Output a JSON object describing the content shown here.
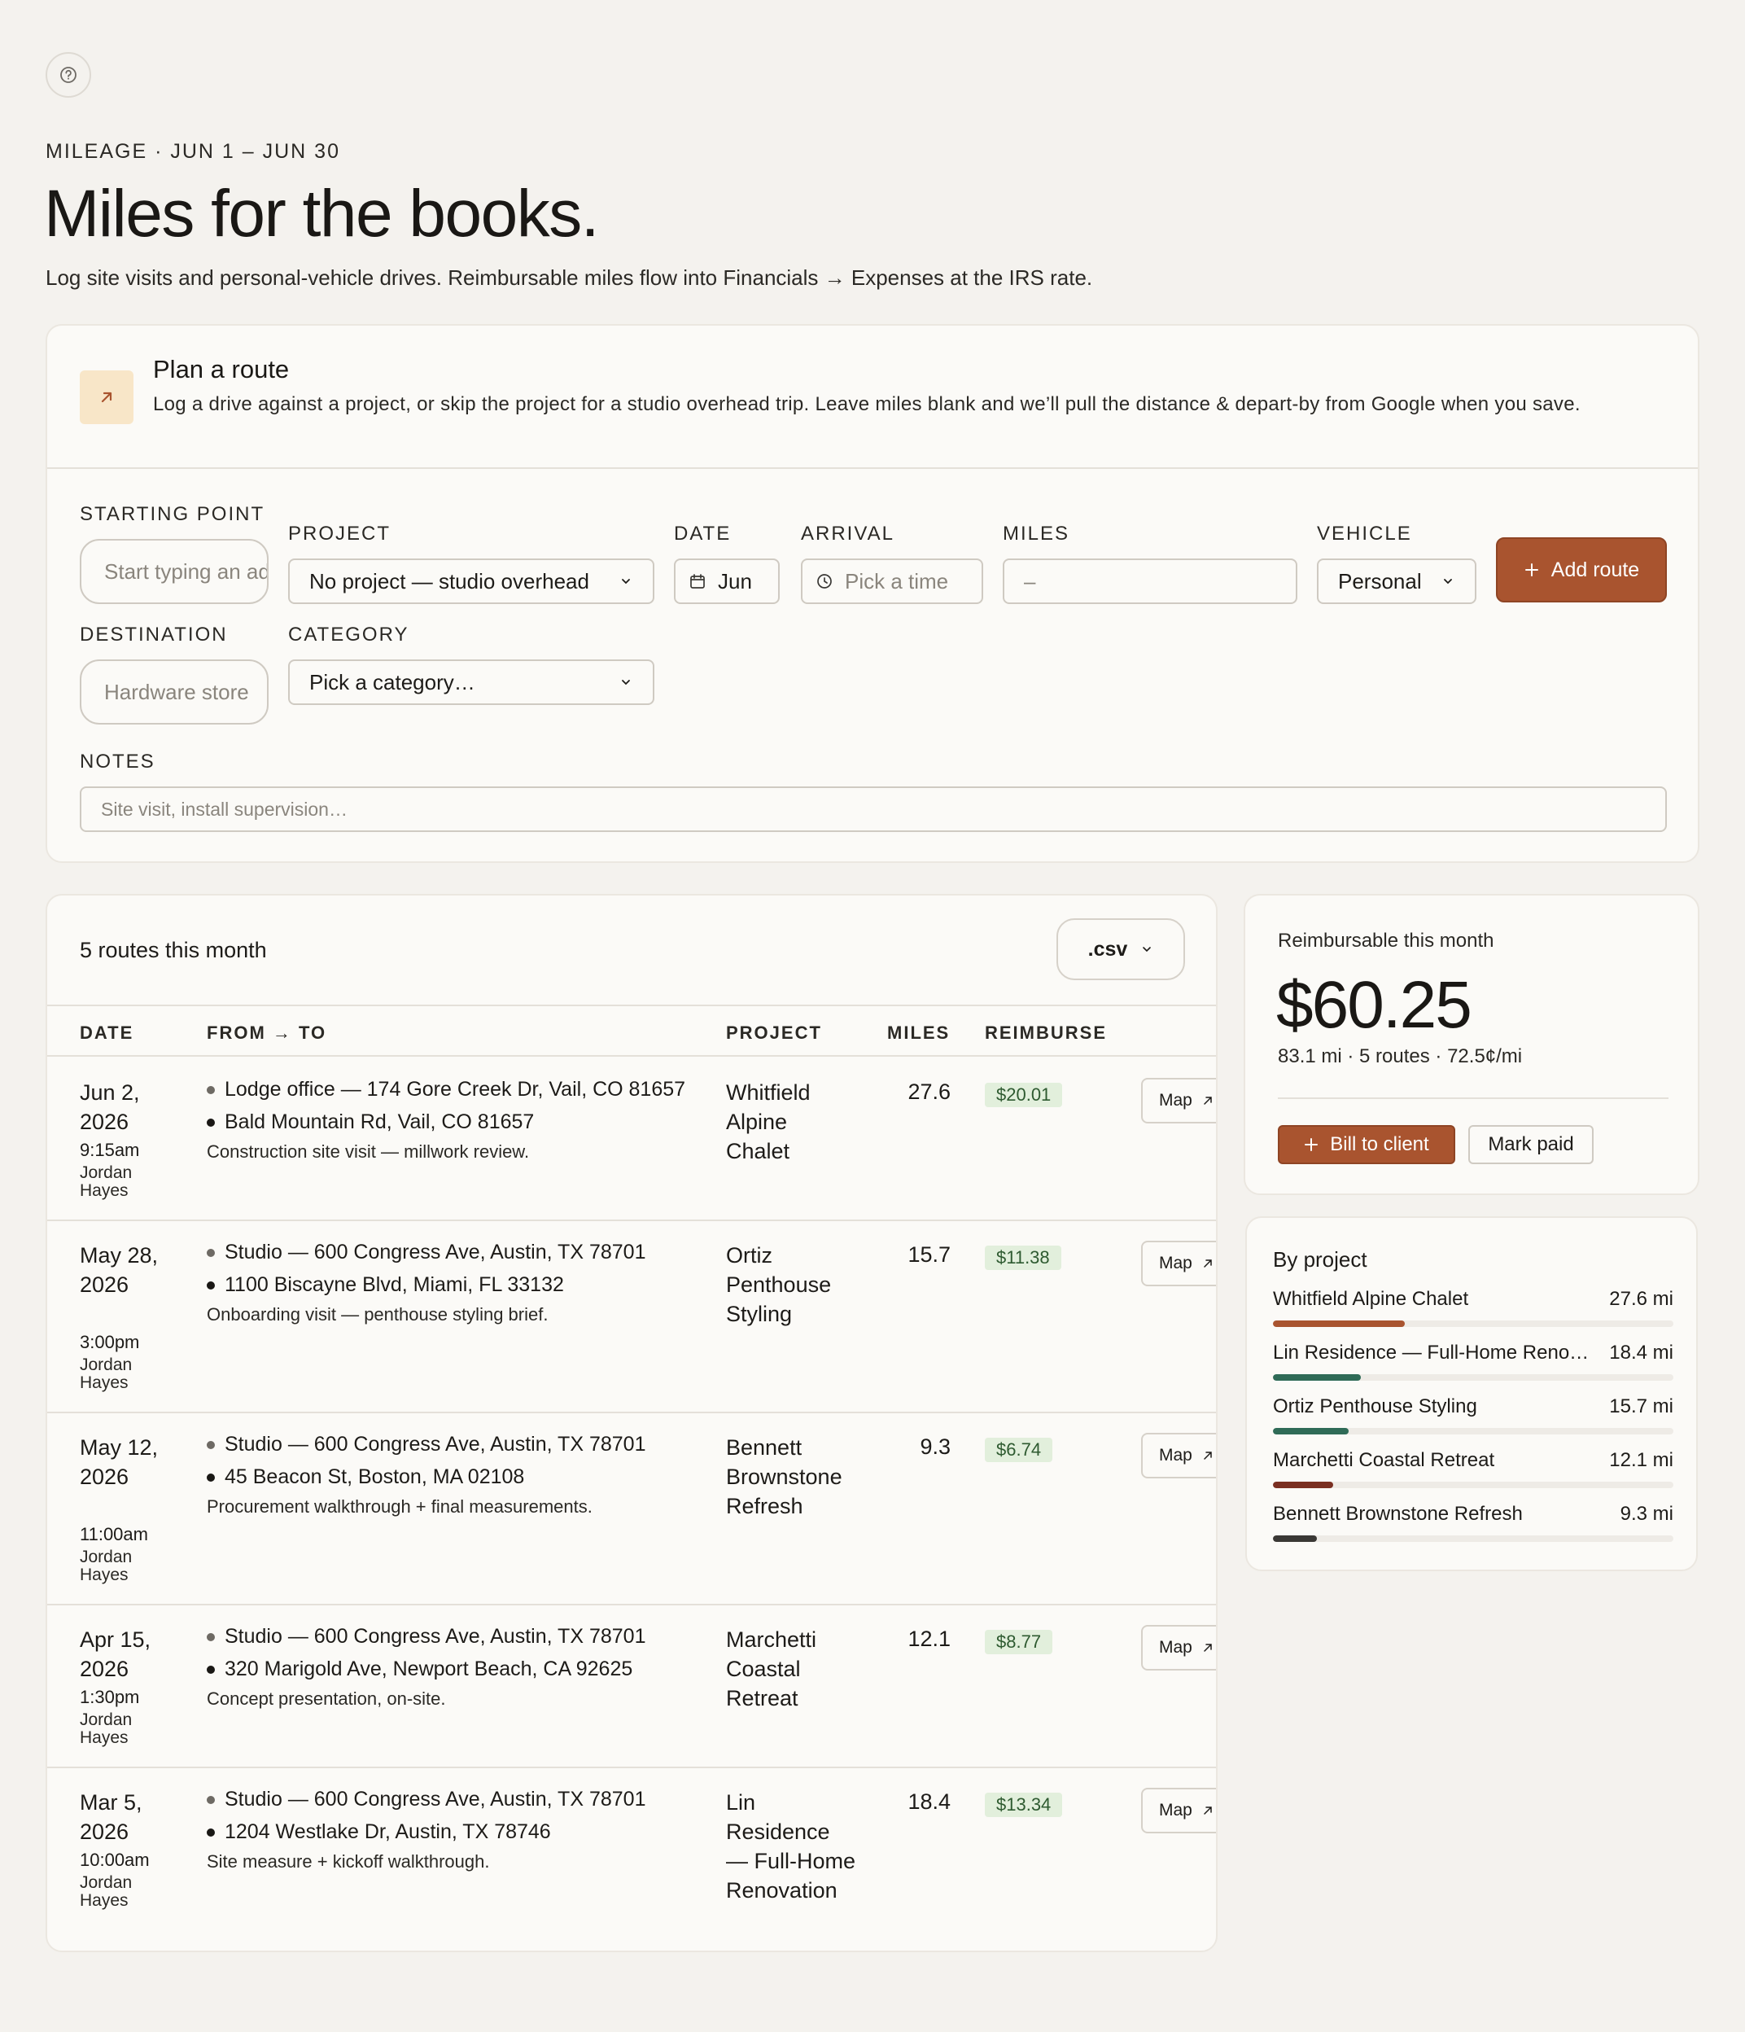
{
  "header": {
    "eyebrow": "MILEAGE · JUN 1 – JUN 30",
    "title": "Miles for the books.",
    "subtitle": "Log site visits and personal-vehicle drives. Reimbursable miles flow into Financials → Expenses at the IRS rate.",
    "help_icon": "question-circle-icon"
  },
  "plan": {
    "title": "Plan a route",
    "description": "Log a drive against a project, or skip the project for a studio overhead trip. Leave miles blank and we’ll pull the distance & depart-by from Google when you save.",
    "icon": "arrow-up-right-icon",
    "labels": {
      "starting_point": "STARTING POINT",
      "project": "PROJECT",
      "date": "DATE",
      "arrival": "ARRIVAL",
      "miles": "MILES",
      "vehicle": "VEHICLE",
      "destination": "DESTINATION",
      "category": "CATEGORY",
      "notes": "NOTES"
    },
    "fields": {
      "starting_point_placeholder": "Start typing an address",
      "project_value": "No project — studio overhead",
      "date_value": "Jun",
      "arrival_placeholder": "Pick a time",
      "miles_placeholder": "–",
      "vehicle_value": "Personal",
      "destination_placeholder": "Hardware store",
      "category_value": "Pick a category…",
      "notes_placeholder": "Site visit, install supervision…"
    },
    "add_route_label": "Add route"
  },
  "routes": {
    "count_label": "5 routes this month",
    "csv_label": ".csv",
    "columns": [
      "DATE",
      "FROM → TO",
      "PROJECT",
      "MILES",
      "REIMBURSE"
    ],
    "map_label": "Map",
    "rows": [
      {
        "date": "Jun 2, 2026",
        "time": "9:15am",
        "driver": "Jordan Hayes",
        "from": "Lodge office — 174 Gore Creek Dr, Vail, CO 81657",
        "to": "Bald Mountain Rd, Vail, CO 81657",
        "note": "Construction site visit — millwork review.",
        "project": "Whitfield Alpine Chalet",
        "miles": "27.6",
        "reimburse": "$20.01"
      },
      {
        "date": "May 28, 2026",
        "time": "3:00pm",
        "driver": "Jordan Hayes",
        "from": "Studio — 600 Congress Ave, Austin, TX 78701",
        "to": "1100 Biscayne Blvd, Miami, FL 33132",
        "note": "Onboarding visit — penthouse styling brief.",
        "project": "Ortiz Penthouse Styling",
        "miles": "15.7",
        "reimburse": "$11.38"
      },
      {
        "date": "May 12, 2026",
        "time": "11:00am",
        "driver": "Jordan Hayes",
        "from": "Studio — 600 Congress Ave, Austin, TX 78701",
        "to": "45 Beacon St, Boston, MA 02108",
        "note": "Procurement walkthrough + final measurements.",
        "project": "Bennett Brownstone Refresh",
        "miles": "9.3",
        "reimburse": "$6.74"
      },
      {
        "date": "Apr 15, 2026",
        "time": "1:30pm",
        "driver": "Jordan Hayes",
        "from": "Studio — 600 Congress Ave, Austin, TX 78701",
        "to": "320 Marigold Ave, Newport Beach, CA 92625",
        "note": "Concept presentation, on-site.",
        "project": "Marchetti Coastal Retreat",
        "miles": "12.1",
        "reimburse": "$8.77"
      },
      {
        "date": "Mar 5, 2026",
        "time": "10:00am",
        "driver": "Jordan Hayes",
        "from": "Studio — 600 Congress Ave, Austin, TX 78701",
        "to": "1204 Westlake Dr, Austin, TX 78746",
        "note": "Site measure + kickoff walkthrough.",
        "project": "Lin Residence — Full-Home Renovation",
        "miles": "18.4",
        "reimburse": "$13.34"
      }
    ]
  },
  "reimbursable": {
    "label": "Reimbursable this month",
    "amount": "$60.25",
    "meta": "83.1 mi · 5 routes · 72.5¢/mi",
    "bill_label": "Bill to client",
    "paid_label": "Mark paid"
  },
  "by_project": {
    "title": "By project",
    "items": [
      {
        "name": "Whitfield Alpine Chalet",
        "miles": "27.6 mi",
        "share": 0.33,
        "color": "#a9542f"
      },
      {
        "name": "Lin Residence — Full-Home Renovation",
        "miles": "18.4 mi",
        "share": 0.22,
        "color": "#2f6b57"
      },
      {
        "name": "Ortiz Penthouse Styling",
        "miles": "15.7 mi",
        "share": 0.19,
        "color": "#2f6b57"
      },
      {
        "name": "Marchetti Coastal Retreat",
        "miles": "12.1 mi",
        "share": 0.15,
        "color": "#7a2f22"
      },
      {
        "name": "Bennett Brownstone Refresh",
        "miles": "9.3 mi",
        "share": 0.11,
        "color": "#3a3835"
      }
    ]
  },
  "colors": {
    "accent": "#a9542f",
    "background": "#f4f2ee",
    "card": "#fbfaf7",
    "reimburse_badge": "#e2efdc"
  }
}
